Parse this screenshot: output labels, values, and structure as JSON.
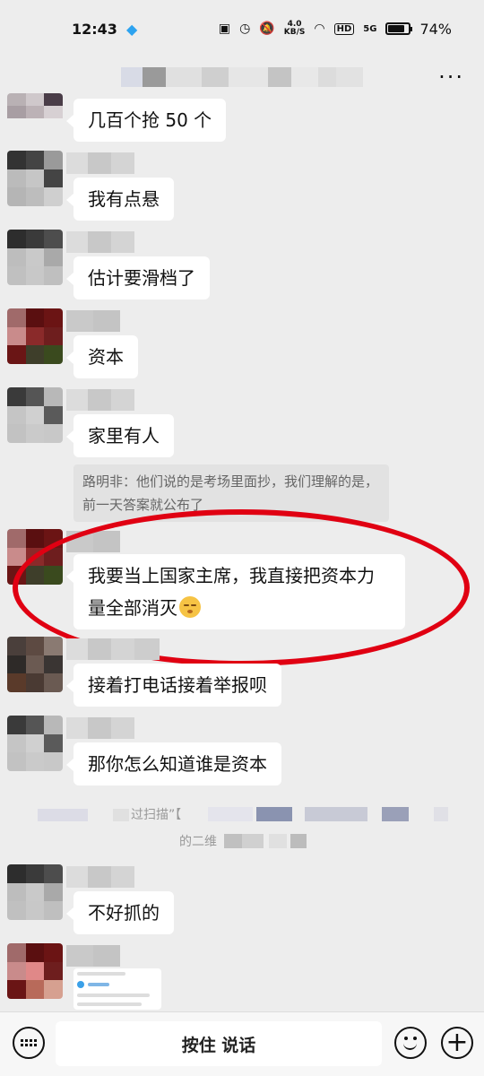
{
  "status_bar": {
    "time": "12:43",
    "network_speed_value": "4.0",
    "network_speed_unit": "KB/S",
    "battery": "74%",
    "signal_label": "5G",
    "hd_label": "HD"
  },
  "header": {
    "more_label": "···"
  },
  "messages": [
    {
      "text": "几百个抢 50 个"
    },
    {
      "text": "我有点悬"
    },
    {
      "text": "估计要滑档了"
    },
    {
      "text": "资本"
    },
    {
      "text": "家里有人"
    },
    {
      "text": "我要当上国家主席，我直接把资本力量全部消灭"
    },
    {
      "text": "接着打电话接着举报呗"
    },
    {
      "text": "那你怎么知道谁是资本"
    },
    {
      "text": "不好抓的"
    }
  ],
  "quote": {
    "text": "路明非：他们说的是考场里面抄，我们理解的是，前一天答案就公布了"
  },
  "system_message": {
    "fragment_1": "过扫描”【",
    "fragment_2": "的二维"
  },
  "bottom_bar": {
    "voice_label": "按住 说话"
  },
  "colors": {
    "background": "#ededed",
    "bubble": "#ffffff",
    "highlight_ring": "#e00012"
  }
}
